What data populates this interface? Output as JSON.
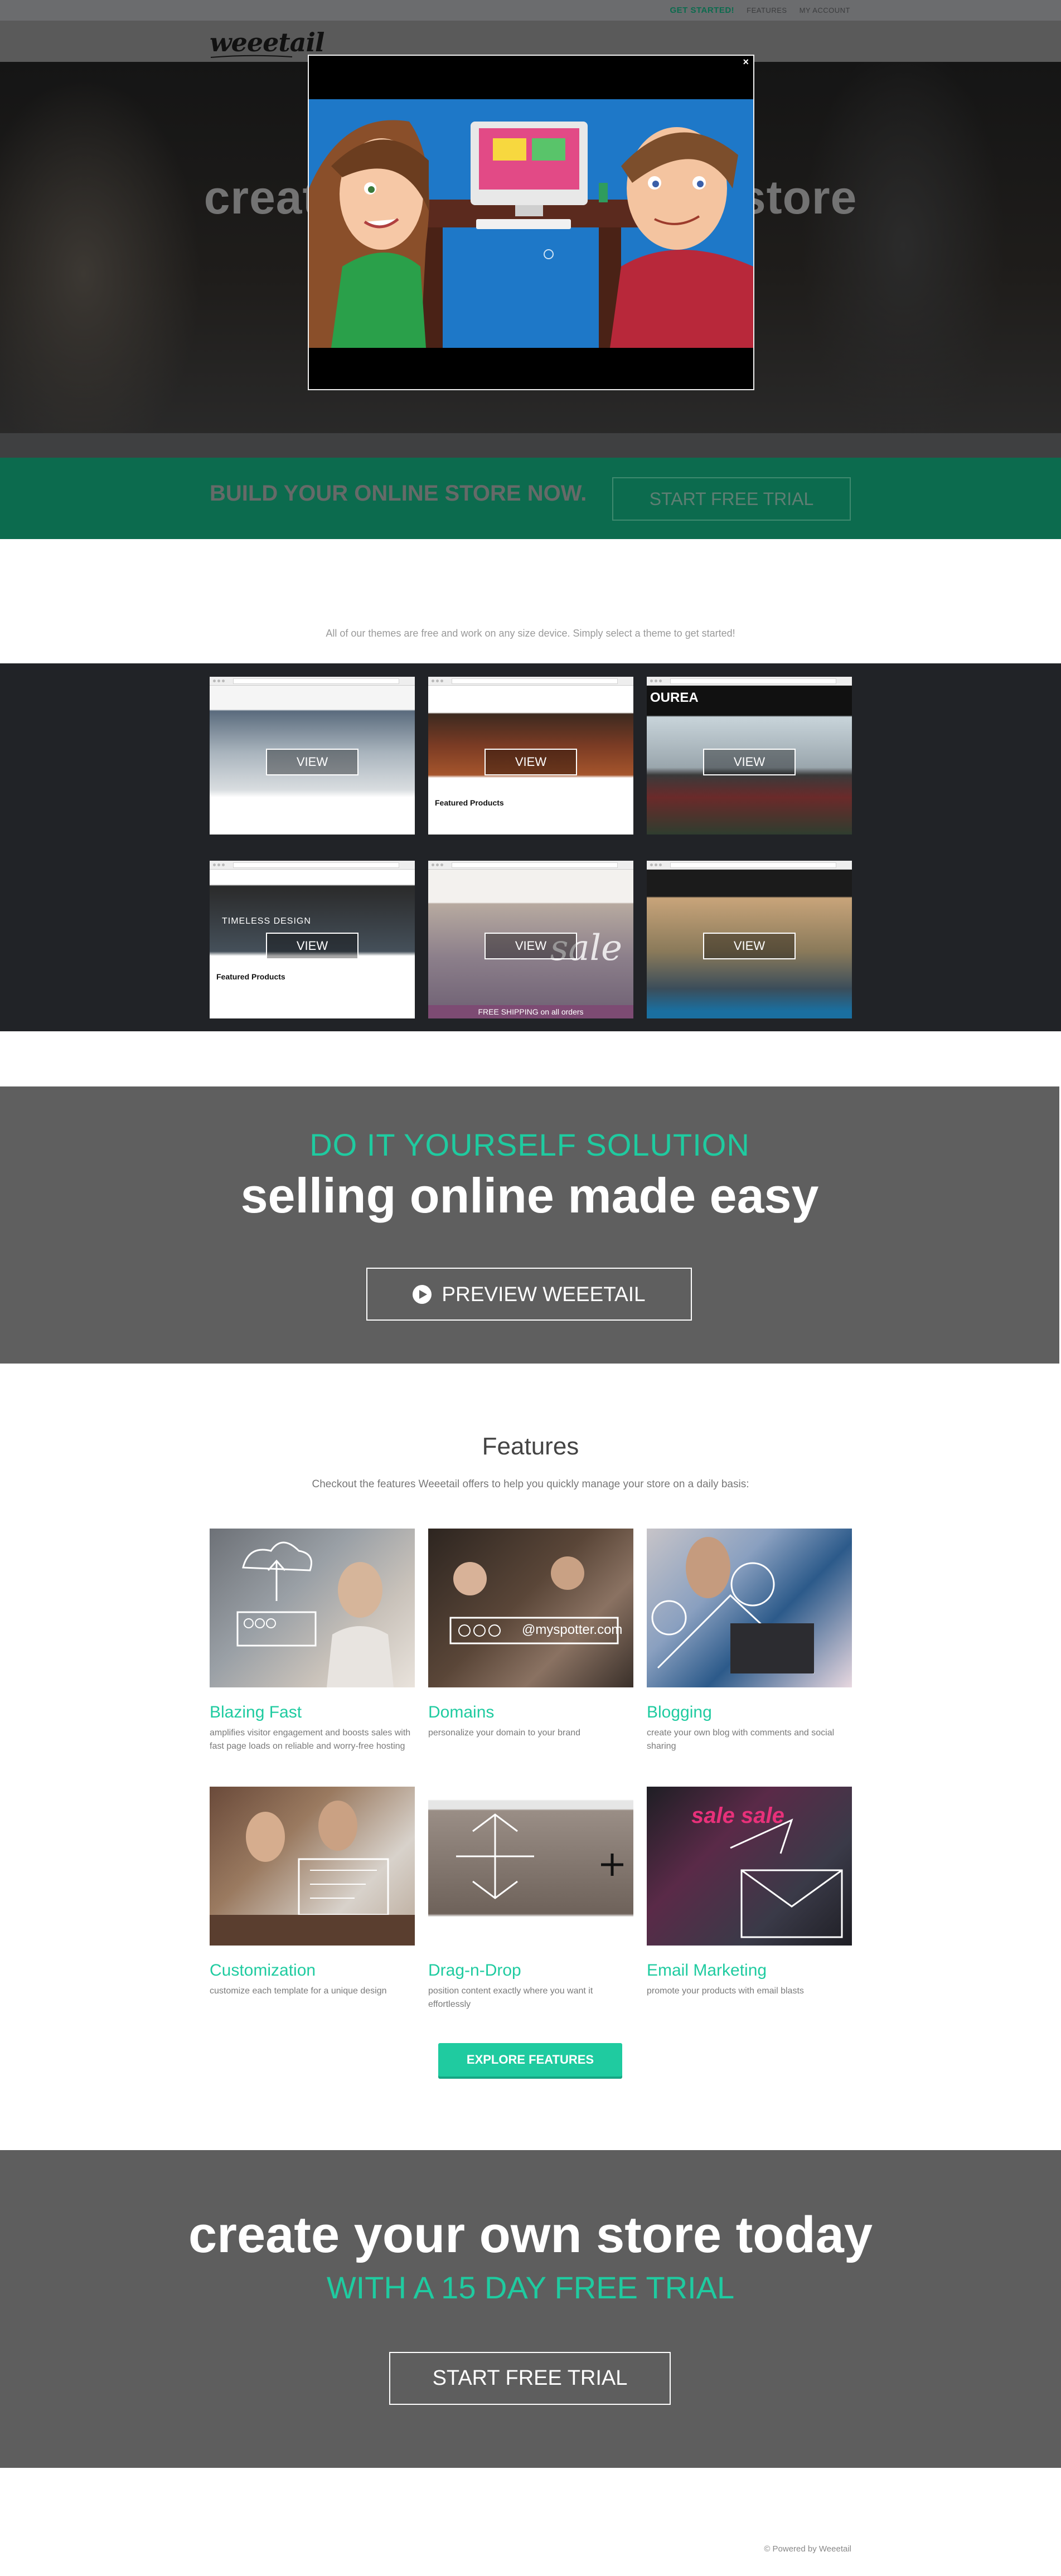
{
  "colors": {
    "brand_green": "#0c6b4e",
    "accent_teal": "#1fcba0",
    "dark_band": "#212327",
    "gray_band": "#5f5f5f"
  },
  "topnav": {
    "cta": "GET STARTED!",
    "features": "FEATURES",
    "account": "MY ACCOUNT"
  },
  "header": {
    "logo": "weeetail"
  },
  "hero": {
    "title": "create your own online store"
  },
  "modal": {
    "close": "×"
  },
  "cta_band": {
    "headline": "BUILD YOUR ONLINE STORE NOW.",
    "subtext": "",
    "button": "START FREE TRIAL"
  },
  "themes": {
    "intro": "All of our themes are free and work on any size device. Simply select a theme to get started!",
    "view_label": "VIEW",
    "card_texts": {
      "featured": "Featured Products",
      "brand": "OUREA",
      "timeless": "TIMELESS DESIGN",
      "sale": "sale",
      "free_ship": "FREE SHIPPING on all orders",
      "featured2": "Featured Products"
    }
  },
  "diy": {
    "kicker": "DO IT YOURSELF SOLUTION",
    "title": "selling online made easy",
    "button": "PREVIEW WEEETAIL"
  },
  "features": {
    "title": "Features",
    "subtitle": "Checkout the features Weeetail offers to help you quickly manage your store on a daily basis:",
    "items": [
      {
        "name": "Blazing Fast",
        "desc": "amplifies visitor engagement and boosts sales with fast page loads on reliable and worry-free hosting"
      },
      {
        "name": "Domains",
        "desc": "personalize your domain to your brand"
      },
      {
        "name": "Blogging",
        "desc": "create your own blog with comments and social sharing"
      },
      {
        "name": "Customization",
        "desc": "customize each template for a unique design"
      },
      {
        "name": "Drag-n-Drop",
        "desc": "position content exactly where you want it effortlessly"
      },
      {
        "name": "Email Marketing",
        "desc": "promote your products with email blasts"
      }
    ],
    "domain_overlay": "@myspotter.com",
    "sale_sign": "sale sale",
    "explore_button": "EXPLORE FEATURES"
  },
  "bottom_cta": {
    "title": "create your own store today",
    "kicker": "WITH A 15 DAY FREE TRIAL",
    "button": "START FREE TRIAL"
  },
  "footer": {
    "credit": "© Powered by Weeetail"
  }
}
